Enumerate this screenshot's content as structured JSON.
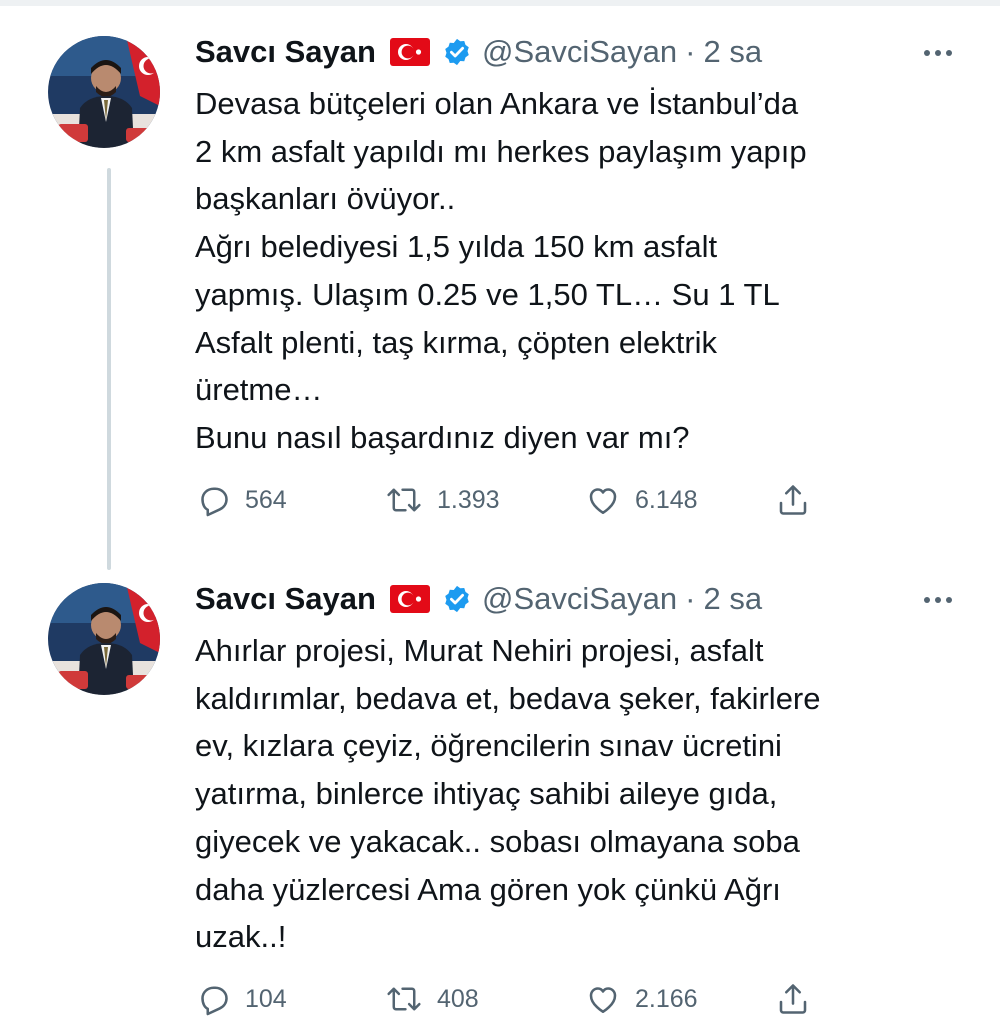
{
  "colors": {
    "text_primary": "#0f1419",
    "text_secondary": "#536471",
    "verified_blue": "#1d9bf0",
    "thread_line": "#cfd9de",
    "flag_red": "#e30a17"
  },
  "tweets": [
    {
      "author": {
        "name": "Savcı Sayan",
        "handle": "@SavciSayan",
        "verified": true,
        "flag_icon": "turkey-flag-icon"
      },
      "separator": "·",
      "time": "2 sa",
      "body_lines": [
        "Devasa bütçeleri olan Ankara ve İstanbul’da",
        "2 km asfalt yapıldı mı herkes paylaşım yapıp",
        "başkanları övüyor..",
        "Ağrı belediyesi 1,5 yılda 150 km asfalt",
        "yapmış. Ulaşım 0.25 ve 1,50 TL… Su 1 TL",
        "Asfalt plenti, taş kırma, çöpten elektrik",
        "üretme…",
        "Bunu nasıl başardınız diyen var mı?"
      ],
      "stats": {
        "replies": "564",
        "retweets": "1.393",
        "likes": "6.148"
      }
    },
    {
      "author": {
        "name": "Savcı Sayan",
        "handle": "@SavciSayan",
        "verified": true,
        "flag_icon": "turkey-flag-icon"
      },
      "separator": "·",
      "time": "2 sa",
      "body_lines": [
        "Ahırlar projesi, Murat Nehiri projesi, asfalt",
        "kaldırımlar, bedava et, bedava şeker, fakirlere",
        "ev, kızlara çeyiz, öğrencilerin sınav ücretini",
        "yatırma, binlerce ihtiyaç sahibi aileye gıda,",
        "giyecek ve yakacak.. sobası olmayana soba",
        "daha yüzlercesi Ama gören yok çünkü Ağrı",
        "uzak..!"
      ],
      "stats": {
        "replies": "104",
        "retweets": "408",
        "likes": "2.166"
      }
    }
  ]
}
